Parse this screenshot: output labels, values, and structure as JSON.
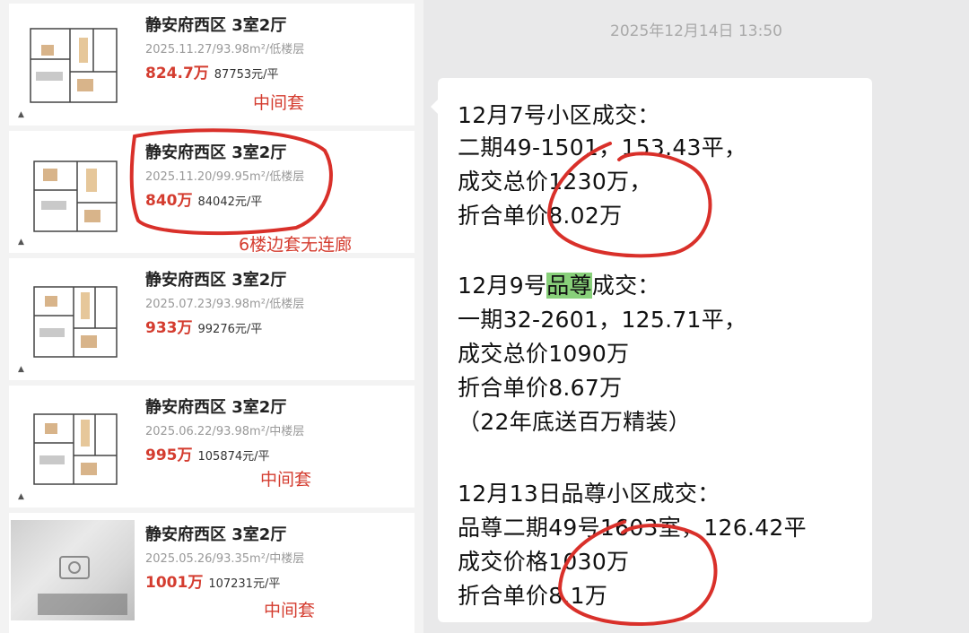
{
  "listings": [
    {
      "title": "静安府西区 3室2厅",
      "meta": "2025.11.27/93.98m²/低楼层",
      "total": "824.7万",
      "unit": "87753元/平",
      "note": "中间套"
    },
    {
      "title": "静安府西区 3室2厅",
      "meta": "2025.11.20/99.95m²/低楼层",
      "total": "840万",
      "unit": "84042元/平",
      "note": "6楼边套无连廊"
    },
    {
      "title": "静安府西区 3室2厅",
      "meta": "2025.07.23/93.98m²/低楼层",
      "total": "933万",
      "unit": "99276元/平",
      "note": ""
    },
    {
      "title": "静安府西区 3室2厅",
      "meta": "2025.06.22/93.98m²/中楼层",
      "total": "995万",
      "unit": "105874元/平",
      "note": "中间套"
    },
    {
      "title": "静安府西区 3室2厅",
      "meta": "2025.05.26/93.35m²/中楼层",
      "total": "1001万",
      "unit": "107231元/平",
      "note": "中间套"
    }
  ],
  "chat": {
    "timestamp": "2025年12月14日 13:50",
    "lines": [
      "12月7号小区成交：",
      "二期49-1501，153.43平，",
      "成交总价1230万，",
      "折合单价8.02万",
      "12月9号",
      "品尊",
      "成交：",
      "一期32-2601，125.71平，",
      "成交总价1090万",
      "折合单价8.67万",
      "（22年底送百万精装）",
      "12月13日品尊小区成交：",
      "品尊二期49号1603室，126.42平",
      "成交价格1030万",
      "折合单价8.1万"
    ]
  },
  "colors": {
    "accent_red": "#d43c2f",
    "highlight_green": "#88d07a",
    "chat_bg": "#e9e9ea",
    "list_bg": "#f3f3f3"
  }
}
